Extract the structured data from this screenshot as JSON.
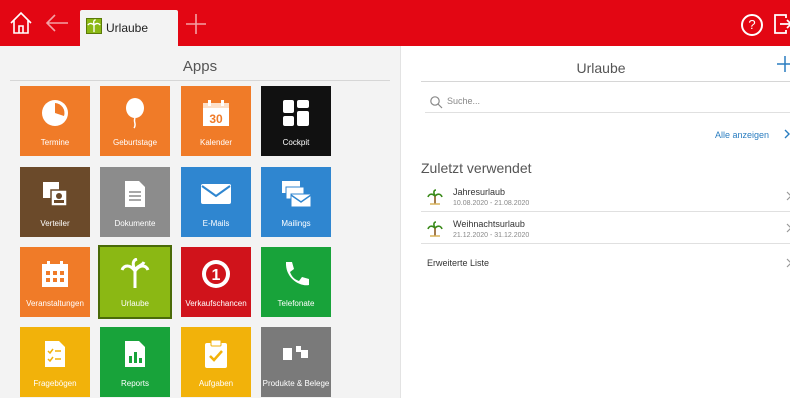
{
  "topbar": {
    "tab_label": "Urlaube",
    "brand_color": "#e30613",
    "help_label": "?"
  },
  "apps": {
    "title": "Apps",
    "tiles": [
      {
        "label": "Termine",
        "icon": "pie-clock-icon",
        "color": "#f07b28"
      },
      {
        "label": "Geburtstage",
        "icon": "balloon-icon",
        "color": "#f07b28"
      },
      {
        "label": "Kalender",
        "icon": "calendar-30-icon",
        "color": "#f07b28"
      },
      {
        "label": "Cockpit",
        "icon": "dashboard-grid-icon",
        "color": "#111111"
      },
      {
        "label": "Verteiler",
        "icon": "contacts-stack-icon",
        "color": "#6b4a2a"
      },
      {
        "label": "Dokumente",
        "icon": "document-icon",
        "color": "#8c8c8c"
      },
      {
        "label": "E-Mails",
        "icon": "envelope-icon",
        "color": "#2f86d0"
      },
      {
        "label": "Mailings",
        "icon": "envelopes-stack-icon",
        "color": "#2f86d0"
      },
      {
        "label": "Veranstaltungen",
        "icon": "event-calendar-icon",
        "color": "#f07b28"
      },
      {
        "label": "Urlaube",
        "icon": "palm-tree-icon",
        "color": "#8bb814"
      },
      {
        "label": "Verkaufschancen",
        "icon": "circled-one-icon",
        "color": "#d0131b"
      },
      {
        "label": "Telefonate",
        "icon": "phone-icon",
        "color": "#18a33a"
      },
      {
        "label": "Fragebögen",
        "icon": "checklist-icon",
        "color": "#f2b20a"
      },
      {
        "label": "Reports",
        "icon": "bar-chart-icon",
        "color": "#18a33a"
      },
      {
        "label": "Aufgaben",
        "icon": "clipboard-check-icon",
        "color": "#f2b20a"
      },
      {
        "label": "Produkte & Belege",
        "icon": "products-icon",
        "color": "#7a7a7a"
      }
    ]
  },
  "panel": {
    "title": "Urlaube",
    "search_placeholder": "Suche...",
    "show_all": "Alle anzeigen",
    "recent_title": "Zuletzt verwendet",
    "items": [
      {
        "name": "Jahresurlaub",
        "dates": "10.08.2020 - 21.08.2020"
      },
      {
        "name": "Weihnachtsurlaub",
        "dates": "21.12.2020 - 31.12.2020"
      }
    ],
    "extended_list": "Erweiterte Liste"
  }
}
